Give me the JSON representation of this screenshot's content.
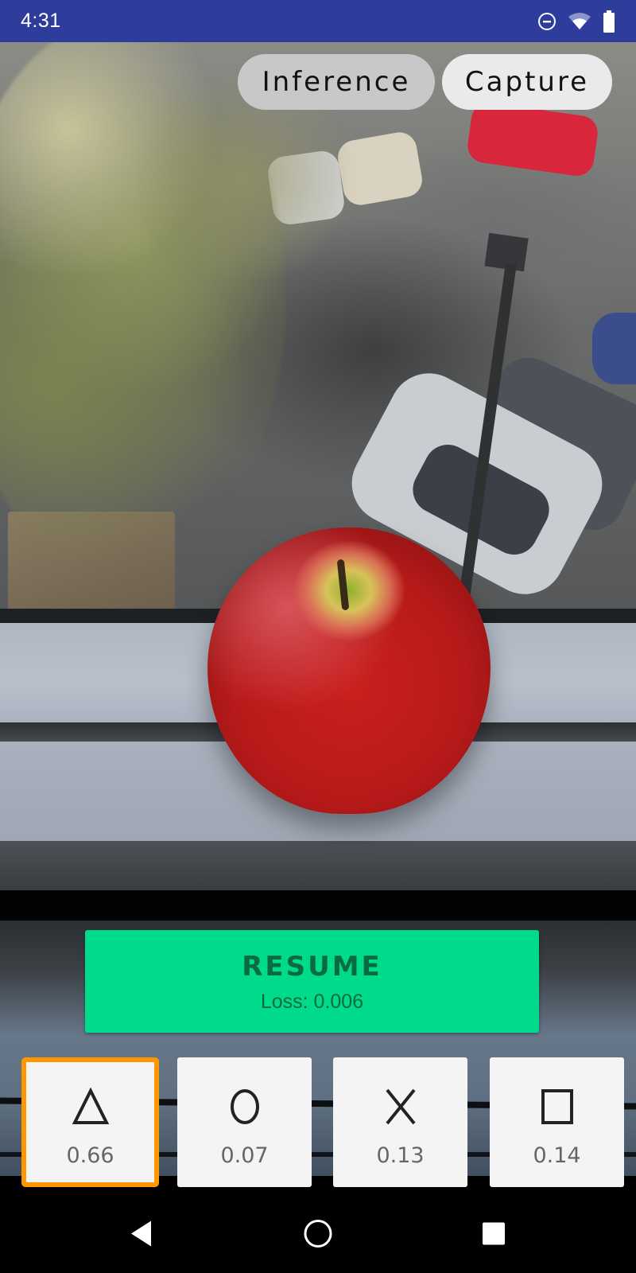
{
  "status_bar": {
    "time": "4:31",
    "icons": [
      "do-not-disturb-icon",
      "wifi-icon",
      "battery-icon"
    ]
  },
  "mode_toggle": {
    "options": [
      {
        "label": "Inference",
        "selected": true
      },
      {
        "label": "Capture",
        "selected": false
      }
    ]
  },
  "resume_button": {
    "label": "RESUME",
    "loss_text": "Loss: 0.006"
  },
  "class_cards": [
    {
      "shape": "triangle-icon",
      "score": "0.66",
      "selected": true
    },
    {
      "shape": "circle-icon",
      "score": "0.07",
      "selected": false
    },
    {
      "shape": "x-icon",
      "score": "0.13",
      "selected": false
    },
    {
      "shape": "square-icon",
      "score": "0.14",
      "selected": false
    }
  ],
  "nav_bar": {
    "buttons": [
      "back-icon",
      "home-icon",
      "recents-icon"
    ]
  },
  "colors": {
    "status_bar": "#2E3C9C",
    "resume_green": "#00DA8B",
    "resume_text": "#0A6B41",
    "selected_border": "#FF9800",
    "card_bg": "#F4F4F4",
    "pill_selected": "#C8C8C8",
    "pill_unselected": "#EAEAEA"
  }
}
